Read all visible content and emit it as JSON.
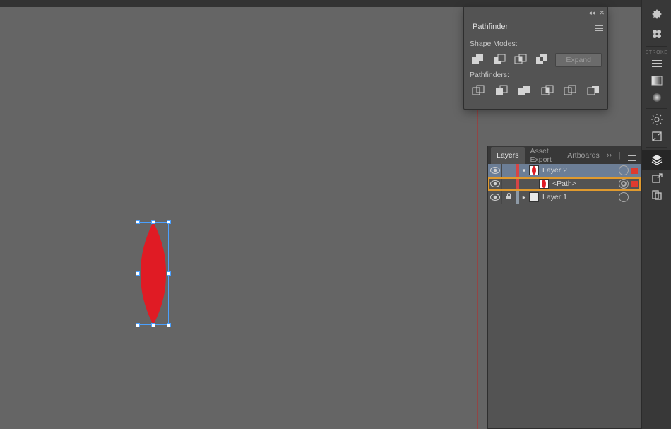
{
  "colors": {
    "shape_fill": "#e01b24",
    "selection_stroke": "#4aa0ff",
    "highlight_row": "#e09a2e",
    "layer_color": "#d64545",
    "header_row_bg": "#6c7e96"
  },
  "pathfinder": {
    "title": "Pathfinder",
    "shape_modes_label": "Shape Modes:",
    "pathfinders_label": "Pathfinders:",
    "expand_label": "Expand",
    "shape_modes": [
      "unite",
      "minus-front",
      "intersect",
      "exclude"
    ],
    "pathfinders": [
      "divide",
      "trim",
      "merge",
      "crop",
      "outline",
      "minus-back"
    ]
  },
  "layers": {
    "tabs": [
      "Layers",
      "Asset Export",
      "Artboards"
    ],
    "active_tab_index": 0,
    "rows": [
      {
        "name": "Layer 2",
        "kind": "layer",
        "expanded": true,
        "visible": true,
        "locked": false,
        "color": "#d64545",
        "selected": false,
        "has_selection_mark": true,
        "header": true,
        "thumb": "petal"
      },
      {
        "name": "<Path>",
        "kind": "path",
        "indent": 1,
        "visible": true,
        "locked": false,
        "color": "#d64545",
        "selected": true,
        "has_selection_mark": true,
        "target_double": true,
        "thumb": "petal"
      },
      {
        "name": "Layer 1",
        "kind": "layer",
        "expanded": false,
        "visible": true,
        "locked": true,
        "color": "#8e9aa6",
        "selected": false,
        "thumb": "blank"
      }
    ]
  },
  "rightbar": {
    "sections": [
      {
        "label": "",
        "items": [
          "recolor-icon",
          "clover-icon"
        ]
      },
      {
        "label": "STROKE",
        "items": [
          "hamburger-icon",
          "gradient-swatch-icon",
          "blur-ball-icon"
        ]
      },
      {
        "label": "",
        "items": [
          "sun-icon",
          "crop-icon"
        ]
      },
      {
        "label": "",
        "items": [
          "layers-icon",
          "share-square-icon",
          "artboards-icon"
        ]
      }
    ],
    "selected": "layers-icon"
  }
}
